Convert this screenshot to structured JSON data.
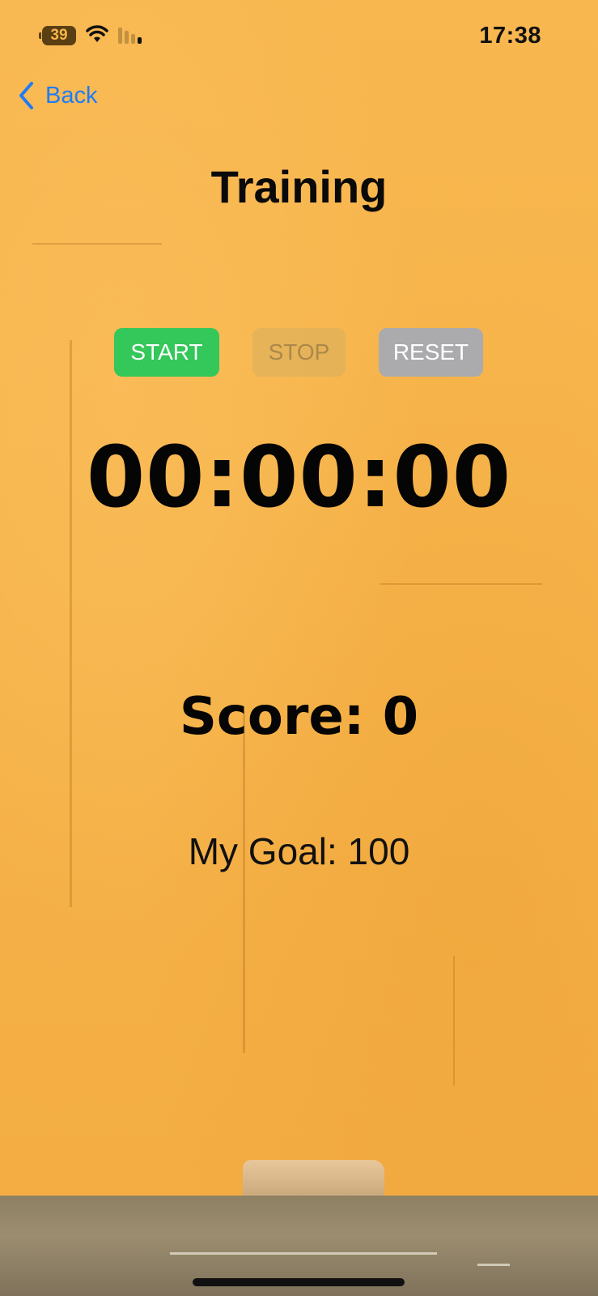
{
  "status_bar": {
    "battery_level": "39",
    "time": "17:38",
    "icons": [
      "wifi-icon",
      "cellular-signal-icon"
    ]
  },
  "nav": {
    "back_label": "Back",
    "back_icon": "chevron-left-icon",
    "accent": "#1f7cf5"
  },
  "page": {
    "title": "Training"
  },
  "controls": {
    "start_label": "START",
    "stop_label": "STOP",
    "reset_label": "RESET",
    "start_color": "#34c759",
    "reset_color": "#ababad",
    "stop_enabled": false
  },
  "stopwatch": {
    "elapsed": "00:00:00"
  },
  "score": {
    "text": "Score: 0",
    "value": 0
  },
  "goal": {
    "text": "My Goal: 100",
    "value": 100
  },
  "theme": {
    "background": "#f7b54b"
  }
}
